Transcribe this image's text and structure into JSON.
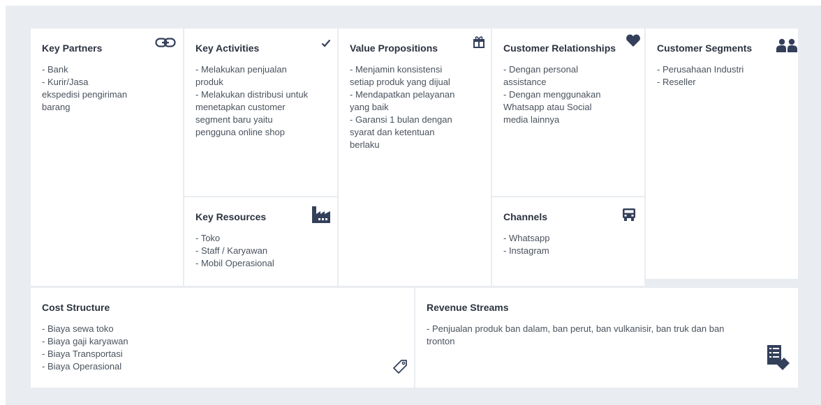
{
  "canvas": {
    "key_partners": {
      "title": "Key Partners",
      "icon": "link-icon",
      "items": [
        "- Bank",
        "- Kurir/Jasa",
        "ekspedisi pengiriman",
        "barang"
      ]
    },
    "key_activities": {
      "title": "Key Activities",
      "icon": "checkmark-icon",
      "items": [
        "- Melakukan penjualan",
        "produk",
        "- Melakukan distribusi untuk",
        "menetapkan customer",
        "segment baru yaitu",
        "pengguna online shop"
      ]
    },
    "key_resources": {
      "title": "Key Resources",
      "icon": "factory-icon",
      "items": [
        "- Toko",
        "- Staff / Karyawan",
        "- Mobil Operasional"
      ]
    },
    "value_propositions": {
      "title": "Value Propositions",
      "icon": "gift-icon",
      "items": [
        "- Menjamin konsistensi",
        "setiap produk yang dijual",
        "- Mendapatkan pelayanan",
        "yang baik",
        "- Garansi 1 bulan dengan",
        "syarat dan ketentuan",
        "berlaku"
      ]
    },
    "customer_relationships": {
      "title": "Customer Relationships",
      "icon": "heart-icon",
      "items": [
        "- Dengan personal",
        "assistance",
        "- Dengan menggunakan",
        "Whatsapp atau Social",
        "media lainnya"
      ]
    },
    "channels": {
      "title": "Channels",
      "icon": "truck-icon",
      "items": [
        "- Whatsapp",
        "- Instagram"
      ]
    },
    "customer_segments": {
      "title": "Customer Segments",
      "icon": "people-icon",
      "items": [
        "- Perusahaan Industri",
        "- Reseller"
      ]
    },
    "cost_structure": {
      "title": "Cost Structure",
      "icon": "price-tag-icon",
      "items": [
        "- Biaya sewa toko",
        "- Biaya gaji karyawan",
        "- Biaya Transportasi",
        "- Biaya Operasional"
      ]
    },
    "revenue_streams": {
      "title": "Revenue Streams",
      "icon": "invoice-icon",
      "items": [
        "- Penjualan produk ban dalam, ban perut, ban vulkanisir, ban truk dan ban",
        "tronton"
      ]
    }
  },
  "colors": {
    "background": "#e9ecf0",
    "card": "#ffffff",
    "icon": "#34405a"
  }
}
